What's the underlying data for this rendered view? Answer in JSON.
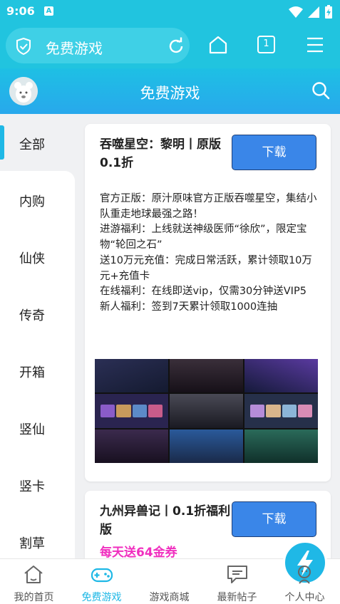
{
  "status_bar": {
    "time": "9:06",
    "notification_badge": "A"
  },
  "browser": {
    "page_title": "免费游戏",
    "tab_count": "1"
  },
  "header": {
    "title": "免费游戏"
  },
  "categories": [
    {
      "label": "全部",
      "active": true
    },
    {
      "label": "内购"
    },
    {
      "label": "仙侠"
    },
    {
      "label": "传奇"
    },
    {
      "label": "开箱"
    },
    {
      "label": "竖仙"
    },
    {
      "label": "竖卡"
    },
    {
      "label": "割草"
    }
  ],
  "games": [
    {
      "title": "吞噬星空：黎明丨原版0.1折",
      "download_label": "下载",
      "description": [
        "官方正版：原汁原味官方正版吞噬星空，集结小队重走地球最强之路！",
        "进游福利：上线就送神级医师“徐欣”，限定宝物“轮回之石”",
        "送10万元充值：完成日常活跃，累计领取10万元+充值卡",
        "在线福利：在线即送vip，仅需30分钟送VIP5",
        "新人福利：签到7天累计领取1000连抽"
      ]
    },
    {
      "title": "九州异兽记丨0.1折福利版",
      "download_label": "下载",
      "promo": "每天送64金券"
    }
  ],
  "bottom_nav": [
    {
      "label": "我的首页",
      "icon": "home-icon"
    },
    {
      "label": "免费游戏",
      "icon": "gamepad-icon",
      "active": true
    },
    {
      "label": "游戏商城",
      "icon": "lightning-icon"
    },
    {
      "label": "最新帖子",
      "icon": "chat-icon"
    },
    {
      "label": "个人中心",
      "icon": "user-icon"
    }
  ],
  "colors": {
    "accent": "#1fb8e6",
    "toolbar": "#21c4df",
    "download_button": "#3a86e8",
    "promo": "#f02fbf"
  }
}
